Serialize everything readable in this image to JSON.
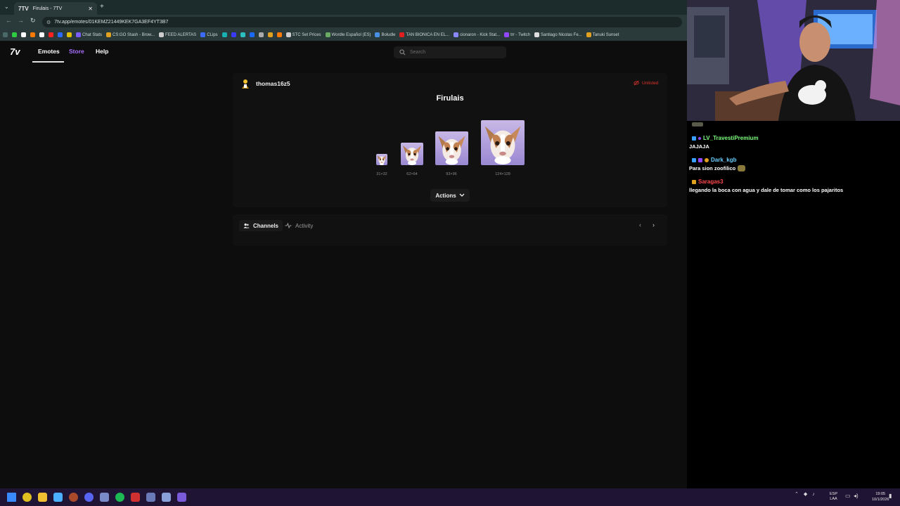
{
  "browser": {
    "tab_title": "Firulais - 7TV",
    "tab_favicon": "7TV",
    "url": "7tv.app/emotes/01KEMZ21449KEK7GA3EF4YT3B7",
    "bookmarks": [
      {
        "label": "Chat Stats",
        "color": "#7b5cff"
      },
      {
        "label": "CS:GO Stash - Brow...",
        "color": "#e0a020"
      },
      {
        "label": "FEED ALERTAS",
        "color": "#cccccc"
      },
      {
        "label": "CLips",
        "color": "#3b6cff"
      },
      {
        "label": "STC Set Prices",
        "color": "#cccccc"
      },
      {
        "label": "Wordle Español (ES)",
        "color": "#6aaa64"
      },
      {
        "label": "Boludle",
        "color": "#4a90e2"
      },
      {
        "label": "TAN BIONICA EN EL...",
        "color": "#e02020"
      },
      {
        "label": "cionaron - Kick Stat...",
        "color": "#8888ff"
      },
      {
        "label": "trr - Twitch",
        "color": "#9146ff"
      },
      {
        "label": "Santiago Nicolas Fe...",
        "color": "#dddddd"
      },
      {
        "label": "Tanuki Sunset",
        "color": "#e0a020"
      }
    ]
  },
  "nav": {
    "logo": "7v",
    "emotes": "Emotes",
    "store": "Store",
    "help": "Help",
    "search_placeholder": "Search"
  },
  "emote": {
    "owner": "thomas16z5",
    "status": "Unlisted",
    "name": "Firulais",
    "sizes": [
      "31×32",
      "62×64",
      "93×96",
      "124×128"
    ],
    "actions_label": "Actions"
  },
  "tabs": {
    "channels": "Channels",
    "activity": "Activity"
  },
  "chat": [
    {
      "user": "LV_TravestiPremium",
      "color": "#7cff7c",
      "message": "JAJAJA"
    },
    {
      "user": "Dark_kgb",
      "color": "#6ad0ff",
      "message": "Para sion zoofilico"
    },
    {
      "user": "Saragas3",
      "color": "#ff4a4a",
      "message": "llegando la boca con agua y dale de tomar como los pajaritos"
    }
  ],
  "taskbar": {
    "lang_top": "ESP",
    "lang_bottom": "LAA",
    "time": "19:05",
    "date": "10/1/2026"
  },
  "colors": {
    "accent_store": "#a970ff",
    "unlisted_red": "#e0342c",
    "taskbar": "#1f1433"
  }
}
